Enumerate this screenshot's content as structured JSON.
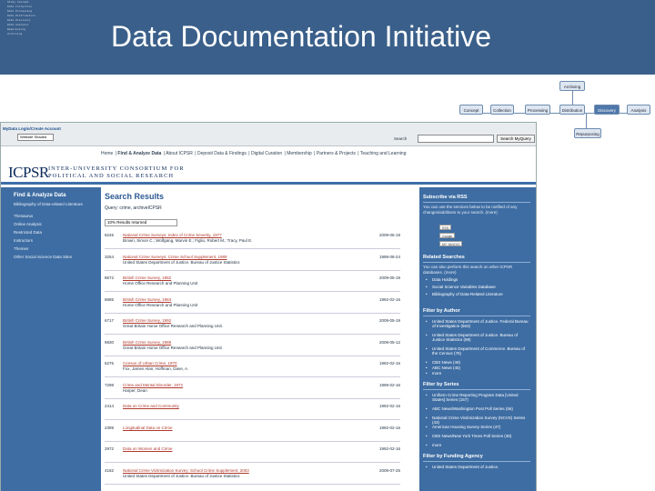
{
  "slide": {
    "title": "Data Documentation Initiative",
    "header_art": [
      "Study Concept",
      "Data Collection",
      "Data Processing",
      "Data Distribution",
      "Data Discovery",
      "Data Analysis",
      "Repurposing",
      "Archiving"
    ]
  },
  "lifecycle": {
    "boxes": [
      "Concept",
      "Collection",
      "Processing",
      "Distribution",
      "Discovery",
      "Analysis"
    ],
    "archiving": "Archiving",
    "repurposing": "Repurposing",
    "highlighted": "Discovery"
  },
  "browser": {
    "toolbar": {
      "label": "MyData Login/Create Account",
      "select": "Website Shaded",
      "search_label": "Search",
      "search_value": "",
      "search_button": "Search MyQuery"
    },
    "topnav": [
      "Home",
      "Find & Analyze Data",
      "About ICPSR",
      "Deposit Data & Findings",
      "Digital Curation",
      "Membership",
      "Partners & Projects",
      "Teaching and Learning"
    ],
    "icpsr": {
      "logo": "ICPSR",
      "name_line1": "INTER-UNIVERSITY CONSORTIUM FOR",
      "name_line2": "POLITICAL AND SOCIAL RESEARCH"
    },
    "sidebar": {
      "title": "Find & Analyze Data",
      "items": [
        "Bibliography of Data-related Literature",
        "Thesaurus",
        "Online Analysis",
        "Restricted Data",
        "Instructors",
        "Themes",
        "Other Social Science Data Sites"
      ]
    },
    "results": {
      "title": "Search Results",
      "query": "Query: crime, archiveICPSR",
      "sort": "10% Results returned",
      "rows": [
        {
          "id": "8245",
          "title": "National Crime Surveys: Index of Crime Severity, 1977",
          "author": "Brown, Simon C.; Wolfgang, Marvin E.; Figlio, Robert M.; Tracy, Paul E.",
          "date": "2009-05-19"
        },
        {
          "id": "3254",
          "title": "National Crime Surveys: Crime School Supplement, 1989",
          "author": "United States Department of Justice. Bureau of Justice Statistics",
          "date": "1998-08-24"
        },
        {
          "id": "8672",
          "title": "British Crime Survey, 1982",
          "author": "Home Office Research and Planning Unit",
          "date": "2009-05-19"
        },
        {
          "id": "8685",
          "title": "British Crime Survey, 1984",
          "author": "Home Office Research and Planning Unit",
          "date": "1992-02-16"
        },
        {
          "id": "6717",
          "title": "British Crime Survey, 1992",
          "author": "Great Britain Home Office Research and Planning Unit.",
          "date": "2009-05-19"
        },
        {
          "id": "9830",
          "title": "British Crime Survey, 1988",
          "author": "Great Britain Home Office Research and Planning Unit",
          "date": "2009-05-12"
        },
        {
          "id": "6275",
          "title": "Census of Urban Crime, 1970",
          "author": "Fox, James Alan; Hoffman, Dave, A.",
          "date": "1992-02-16"
        },
        {
          "id": "7298",
          "title": "Crime and Mental Disorder, 1972",
          "author": "Harper, Dean",
          "date": "1998-02-16"
        },
        {
          "id": "2414",
          "title": "Data on Crime and Community",
          "author": "",
          "date": "1992-02-16"
        },
        {
          "id": "2399",
          "title": "Longitudinal Data on Crime",
          "author": "",
          "date": "1992-02-16"
        },
        {
          "id": "2972",
          "title": "Data on Women and Crime",
          "author": "",
          "date": "1992-02-16"
        },
        {
          "id": "4182",
          "title": "National Crime Victimization Survey: School Crime Supplement, 2003",
          "author": "United States Department of Justice. Bureau of Justice Statistics",
          "date": "2009-07-25"
        }
      ]
    },
    "right": {
      "rss_title": "Subscribe via RSS",
      "rss_text": "You can use the services below to be notified of any changes/additions to your search. (more)",
      "badges": [
        "RSS",
        "Google",
        "MY YAHOO!"
      ],
      "related_title": "Related Searches",
      "related_text": "You can also perform this search on other ICPSR databases. (more)",
      "related_items": [
        "Data Holdings",
        "Social Science Variables Database",
        "Bibliography of Data-Related Literature"
      ],
      "author_title": "Filter by Author",
      "author_items": [
        "United States Department of Justice. Federal Bureau of Investigation (563)",
        "United States Department of Justice. Bureau of Justice Statistics (99)",
        "United States Department of Commerce. Bureau of the Census (75)",
        "CBS News (49)",
        "ABC News (45)",
        "more"
      ],
      "series_title": "Filter by Series",
      "series_items": [
        "Uniform Crime Reporting Program Data [United States] Series (157)",
        "ABC News/Washington Post Poll Series (56)",
        "National Crime Victimization Survey (NCVS) Series (43)",
        "American Housing Survey Series (47)",
        "CBS News/New York Times Poll Series (38)",
        "more"
      ],
      "agency_title": "Filter by Funding Agency",
      "agency_items": [
        "United States Department of Justice."
      ]
    }
  }
}
